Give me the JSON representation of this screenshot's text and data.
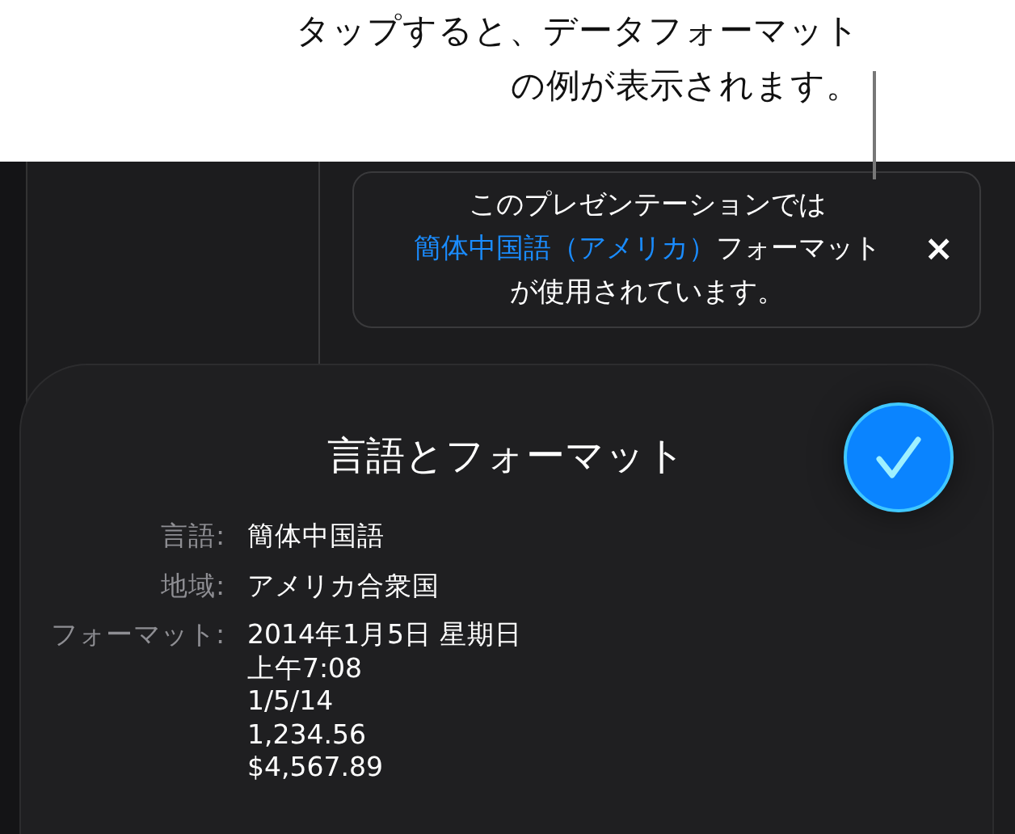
{
  "callout": {
    "lines": [
      "タップすると、データフォーマット",
      "の例が表示されます。"
    ]
  },
  "banner": {
    "text_before": "このプレゼンテーションでは",
    "link": "簡体中国語（アメリカ）",
    "text_after": "フォーマットが使用されています。",
    "close": "×"
  },
  "sheet": {
    "title": "言語とフォーマット",
    "rows": [
      {
        "label": "言語:",
        "values": [
          "簡体中国語"
        ]
      },
      {
        "label": "地域:",
        "values": [
          "アメリカ合衆国"
        ]
      },
      {
        "label": "フォーマット:",
        "values": [
          "2014年1月5日 星期日",
          "上午7:08",
          "1/5/14",
          "1,234.56",
          "$4,567.89"
        ]
      }
    ]
  }
}
